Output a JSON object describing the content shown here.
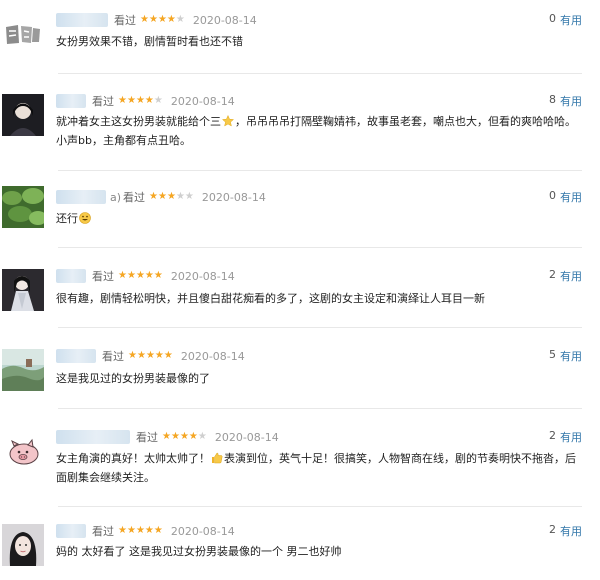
{
  "reviews": [
    {
      "name_tail": "",
      "action": "看过",
      "stars": 4,
      "date": "2020-08-14",
      "votes": "0",
      "useful_label": "有用",
      "text_parts": [
        "女扮男效果不错，剧情暂时看也还不错"
      ],
      "avatar": "gray-logo"
    },
    {
      "name_tail": "",
      "action": "看过",
      "stars": 4,
      "date": "2020-08-14",
      "votes": "8",
      "useful_label": "有用",
      "text_parts": [
        "就冲着女主这女扮男装就能给个三",
        "，吊吊吊吊打隔壁鞠婧祎，故事虽老套，嘲点也大，但看的爽哈哈哈。小声bb，主角都有点丑哈。"
      ],
      "avatar": "dark-person"
    },
    {
      "name_tail": "a)",
      "action": "看过",
      "stars": 3,
      "date": "2020-08-14",
      "votes": "0",
      "useful_label": "有用",
      "text_parts": [
        "还行",
        ""
      ],
      "avatar": "green-leaves"
    },
    {
      "name_tail": "",
      "action": "看过",
      "stars": 5,
      "date": "2020-08-14",
      "votes": "2",
      "useful_label": "有用",
      "text_parts": [
        "很有趣，剧情轻松明快，并且傻白甜花痴看的多了，这剧的女主设定和演绎让人耳目一新"
      ],
      "avatar": "costume"
    },
    {
      "name_tail": "",
      "action": "看过",
      "stars": 5,
      "date": "2020-08-14",
      "votes": "5",
      "useful_label": "有用",
      "text_parts": [
        "这是我见过的女扮男装最像的了"
      ],
      "avatar": "landscape"
    },
    {
      "name_tail": "",
      "action": "看过",
      "stars": 4,
      "date": "2020-08-14",
      "votes": "2",
      "useful_label": "有用",
      "text_parts": [
        "女主角演的真好！太帅太帅了！",
        "表演到位，英气十足！很搞笑，人物智商在线，剧的节奏明快不拖沓，后面剧集会继续关注。"
      ],
      "avatar": "pig"
    },
    {
      "name_tail": "",
      "action": "看过",
      "stars": 5,
      "date": "2020-08-14",
      "votes": "2",
      "useful_label": "有用",
      "text_parts": [
        "妈的 太好看了 这是我见过女扮男装最像的一个 男二也好帅"
      ],
      "avatar": "woman"
    }
  ]
}
